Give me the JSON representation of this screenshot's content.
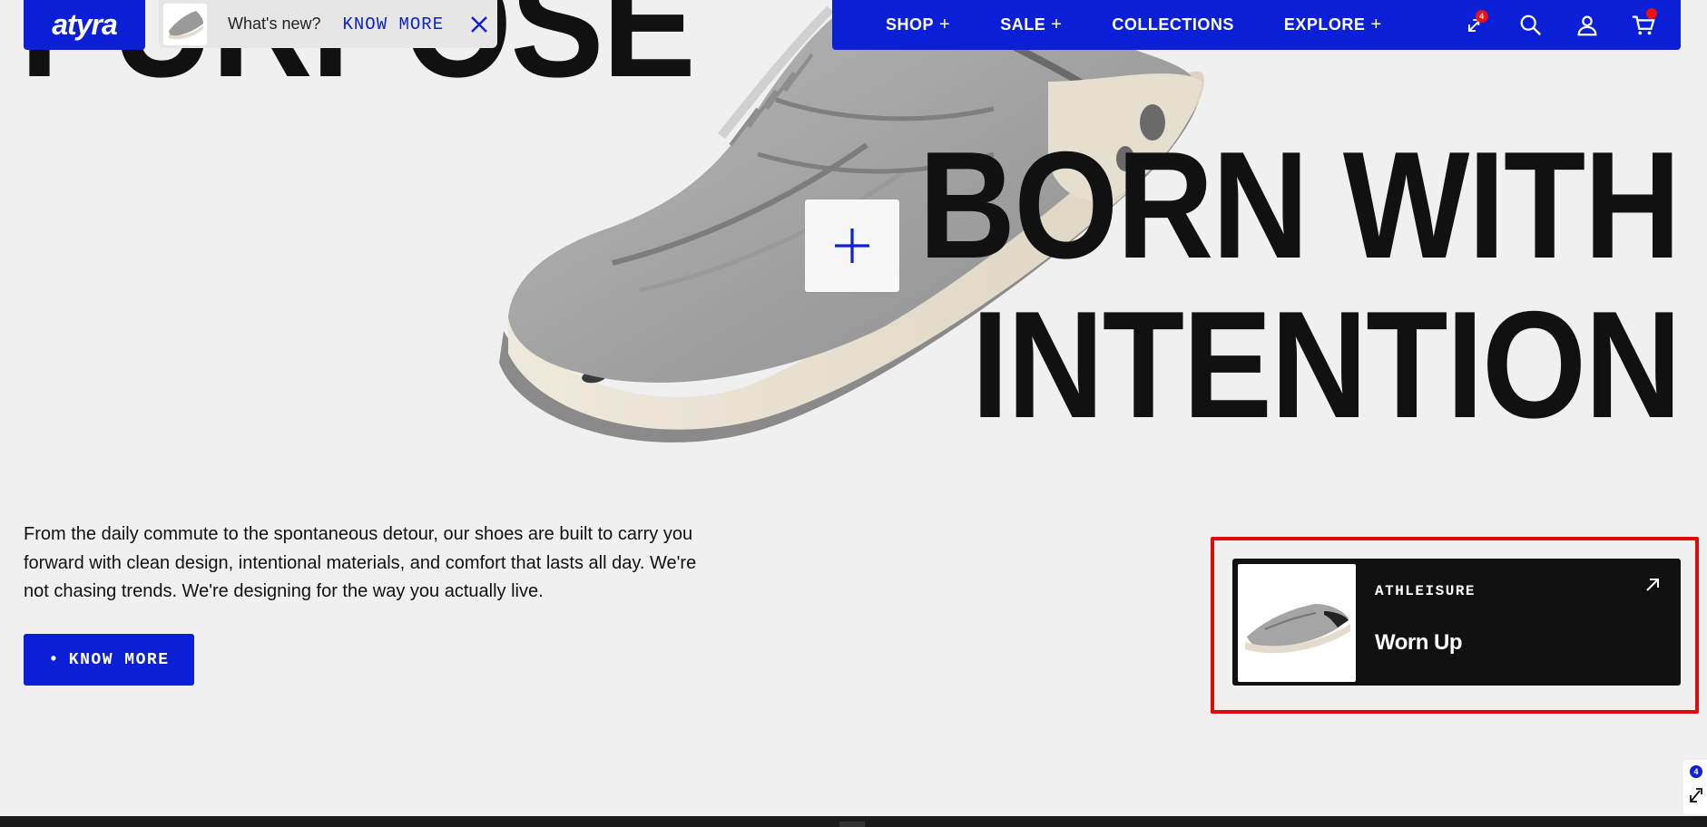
{
  "brand": {
    "logo_text": "atyra",
    "accent_color": "#0a1fd6"
  },
  "announcement": {
    "label": "What's new?",
    "link_label": "KNOW MORE",
    "close_icon": "close-icon"
  },
  "nav": {
    "items": [
      {
        "label": "SHOP",
        "suffix": "+"
      },
      {
        "label": "SALE",
        "suffix": "+"
      },
      {
        "label": "COLLECTIONS",
        "suffix": ""
      },
      {
        "label": "EXPLORE",
        "suffix": "+"
      }
    ],
    "compare_count": "4",
    "icons": [
      "compare-icon",
      "search-icon",
      "account-icon",
      "cart-icon"
    ]
  },
  "hero": {
    "word_top": "PURPOSE",
    "line1": "BORN WITH",
    "line2": "INTENTION",
    "hotspot_symbol": "+",
    "body": "From the daily commute to the spontaneous detour, our shoes are built to carry you forward with clean design, intentional materials, and comfort that lasts all day. We're not chasing trends. We're designing for the way you actually live.",
    "cta_bullet": "•",
    "cta_label": "KNOW MORE"
  },
  "product_card": {
    "category": "ATHLEISURE",
    "name": "Worn Up",
    "icon": "arrow-up-right-icon"
  },
  "side_widget": {
    "count": "4"
  }
}
